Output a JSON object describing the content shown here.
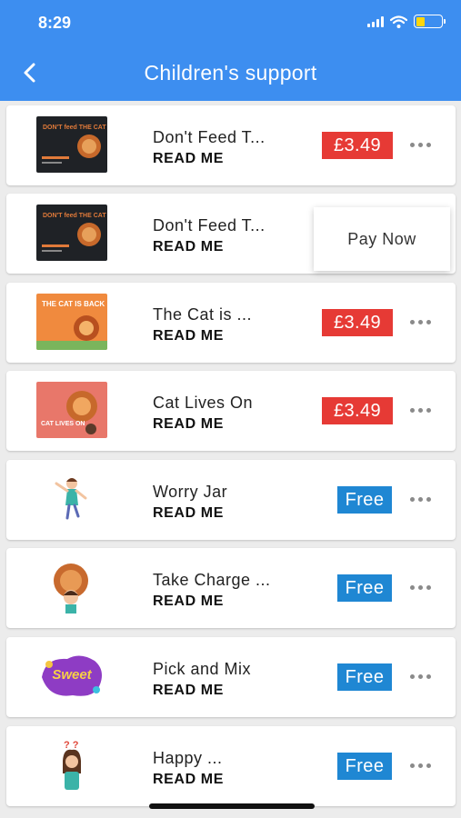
{
  "status_bar": {
    "time": "8:29"
  },
  "header": {
    "title": "Children's support"
  },
  "items": [
    {
      "title": "Don't Feed T...",
      "action": "READ ME",
      "badge": "£3.49",
      "badge_type": "price",
      "cover_text": "DON'T feed THE CAT"
    },
    {
      "title": "Don't Feed T...",
      "action": "READ ME",
      "popover": "Pay Now",
      "cover_text": "DON'T feed THE CAT"
    },
    {
      "title": "The Cat is ...",
      "action": "READ ME",
      "badge": "£3.49",
      "badge_type": "price",
      "cover_text": "THE CAT IS BACK"
    },
    {
      "title": "Cat Lives On",
      "action": "READ ME",
      "badge": "£3.49",
      "badge_type": "price",
      "cover_text": "CAT LIVES ON"
    },
    {
      "title": "Worry Jar",
      "action": "READ ME",
      "badge": "Free",
      "badge_type": "free"
    },
    {
      "title": "Take Charge ...",
      "action": "READ ME",
      "badge": "Free",
      "badge_type": "free"
    },
    {
      "title": "Pick and Mix",
      "action": "READ ME",
      "badge": "Free",
      "badge_type": "free",
      "cover_text": "Sweet"
    },
    {
      "title": "Happy ...",
      "action": "READ ME",
      "badge": "Free",
      "badge_type": "free",
      "cover_text": "? ?"
    }
  ],
  "colors": {
    "header": "#3d8ef0",
    "price_badge": "#e63a35",
    "free_badge": "#1f87d3",
    "battery": "#ffd60a"
  }
}
